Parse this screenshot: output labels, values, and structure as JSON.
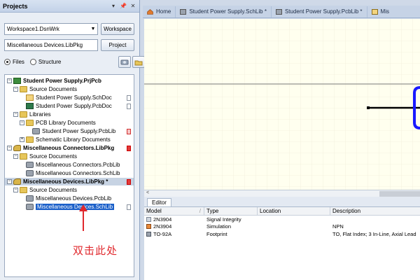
{
  "panel": {
    "title": "Projects",
    "header_icons": [
      "dropdown-icon",
      "pin-icon",
      "close-icon"
    ],
    "workspace_value": "Workspace1.DsnWrk",
    "workspace_button": "Workspace",
    "project_value": "Miscellaneous Devices.LibPkg",
    "project_button": "Project",
    "radio_files": "Files",
    "radio_structure": "Structure",
    "selected_view": "Files"
  },
  "tree": {
    "n0": "Student Power Supply.PrjPcb",
    "n1": "Source Documents",
    "n2": "Student Power Supply.SchDoc",
    "n3": "Student Power Supply.PcbDoc",
    "n4": "Libraries",
    "n5": "PCB Library Documents",
    "n6": "Student Power Supply.PcbLib",
    "n7": "Schematic Library Documents",
    "n8": "Miscellaneous Connectors.LibPkg",
    "n9": "Source Documents",
    "n10": "Miscellaneous Connectors.PcbLib",
    "n11": "Miscellaneous Connectors.SchLib",
    "n12": "Miscellaneous Devices.LibPkg *",
    "n13": "Source Documents",
    "n14": "Miscellaneous Devices.PcbLib",
    "n15": "Miscellaneous Devices.SchLib"
  },
  "annotation": {
    "text": "双击此处",
    "color": "#e0282d"
  },
  "tabs": {
    "t0": "Home",
    "t1": "Student Power Supply.SchLib *",
    "t2": "Student Power Supply.PcbLib *",
    "t3": "Mis"
  },
  "editor": {
    "tab": "Editor",
    "columns": {
      "c0": "Model",
      "c1": "Type",
      "c2": "Location",
      "c3": "Description"
    },
    "rows": [
      {
        "model": "2N3904",
        "type": "Signal Integrity",
        "location": "",
        "description": ""
      },
      {
        "model": "2N3904",
        "type": "Simulation",
        "location": "",
        "description": "NPN"
      },
      {
        "model": "TO-92A",
        "type": "Footprint",
        "location": "",
        "description": "TO, Flat Index; 3 In-Line, Axial Lead"
      }
    ]
  },
  "colors": {
    "selection": "#1a5fc9",
    "pin": "#1a1aff",
    "canvas": "#ffffef"
  }
}
